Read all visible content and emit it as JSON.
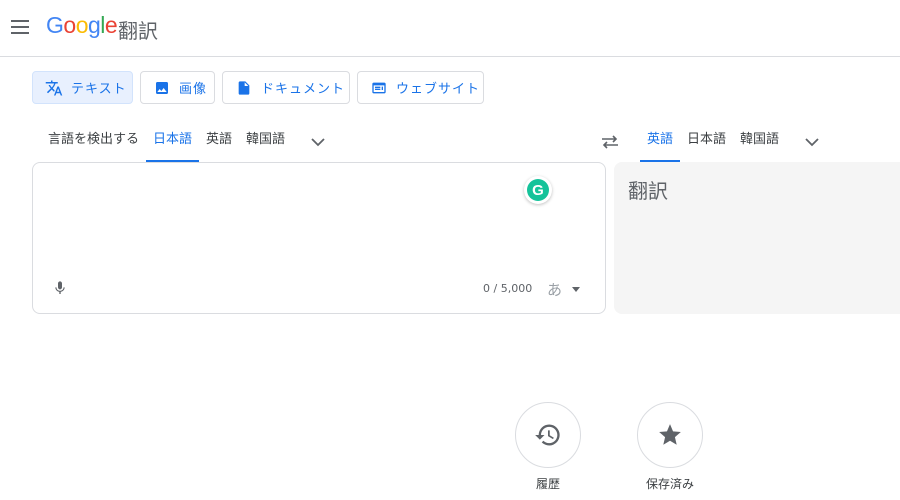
{
  "header": {
    "logo": {
      "g1": "G",
      "o1": "o",
      "o2": "o",
      "g2": "g",
      "l": "l",
      "e": "e"
    },
    "product_name": "翻訳"
  },
  "modes": [
    {
      "label": "テキスト",
      "icon": "translate-icon",
      "active": true
    },
    {
      "label": "画像",
      "icon": "image-icon",
      "active": false
    },
    {
      "label": "ドキュメント",
      "icon": "document-icon",
      "active": false
    },
    {
      "label": "ウェブサイト",
      "icon": "website-icon",
      "active": false
    }
  ],
  "source_langs": [
    {
      "label": "言語を検出する",
      "selected": false
    },
    {
      "label": "日本語",
      "selected": true
    },
    {
      "label": "英語",
      "selected": false
    },
    {
      "label": "韓国語",
      "selected": false
    }
  ],
  "target_langs": [
    {
      "label": "英語",
      "selected": true
    },
    {
      "label": "日本語",
      "selected": false
    },
    {
      "label": "韓国語",
      "selected": false
    }
  ],
  "source": {
    "text": "",
    "char_count": "0 / 5,000",
    "ime_char": "あ"
  },
  "target": {
    "text": "翻訳"
  },
  "bottom": {
    "history_label": "履歴",
    "saved_label": "保存済み"
  },
  "colors": {
    "accent": "#1a73e8",
    "active_mode_bg": "#e8f0fe",
    "target_panel_bg": "#f5f5f5",
    "grammarly": "#15c39a"
  }
}
